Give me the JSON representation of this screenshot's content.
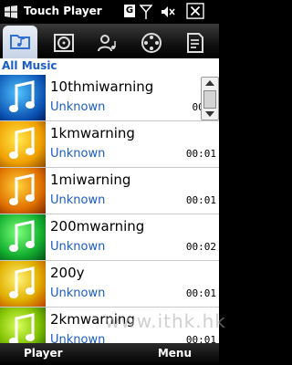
{
  "status_bar": {
    "title": "Touch Player",
    "network_indicator": "G",
    "icons": [
      "windows-logo-icon",
      "signal-icon",
      "volume-icon",
      "close-icon"
    ]
  },
  "tabs": [
    {
      "name": "folder",
      "icon": "music-folder-icon",
      "active": true
    },
    {
      "name": "album",
      "icon": "album-icon",
      "active": false
    },
    {
      "name": "artist",
      "icon": "artist-icon",
      "active": false
    },
    {
      "name": "video",
      "icon": "film-reel-icon",
      "active": false
    },
    {
      "name": "playlist",
      "icon": "playlist-icon",
      "active": false
    }
  ],
  "section": {
    "title": "All Music"
  },
  "tracks": [
    {
      "title": "10thmiwarning",
      "artist": "Unknown",
      "duration": "00:0"
    },
    {
      "title": "1kmwarning",
      "artist": "Unknown",
      "duration": "00:01"
    },
    {
      "title": "1miwarning",
      "artist": "Unknown",
      "duration": "00:01"
    },
    {
      "title": "200mwarning",
      "artist": "Unknown",
      "duration": "00:02"
    },
    {
      "title": "200y",
      "artist": "Unknown",
      "duration": "00:01"
    },
    {
      "title": "2kmwarning",
      "artist": "Unknown",
      "duration": "00:01"
    }
  ],
  "softkeys": {
    "left": "Player",
    "right": "Menu"
  },
  "watermark": "www.ithk.hk",
  "colors": {
    "accent": "#1a5cc7"
  }
}
